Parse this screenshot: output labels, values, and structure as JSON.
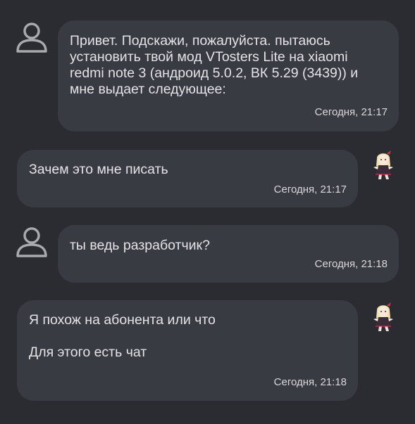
{
  "messages": [
    {
      "sender": "other",
      "text": "Привет. Подскажи, пожалуйста. пытаюсь\nустановить твой мод VTosters Lite на xiaomi\nredmi note 3 (андроид 5.0.2, ВК 5.29 (3439)) и\nмне выдает следующее:",
      "time": "Сегодня, 21:17",
      "avatar": "default-user-icon"
    },
    {
      "sender": "self",
      "text": "Зачем это мне писать",
      "time": "Сегодня, 21:17",
      "avatar": "anime-girl-avatar"
    },
    {
      "sender": "other",
      "text": "ты ведь разработчик?",
      "time": "Сегодня, 21:18",
      "avatar": "default-user-icon"
    },
    {
      "sender": "self",
      "text": "Я похож на абонента или что\n\nДля этого есть чат",
      "time": "Сегодня, 21:18",
      "avatar": "anime-girl-avatar"
    }
  ],
  "colors": {
    "background": "#2a2c31",
    "bubble": "#393b42",
    "text": "#e3e4e8",
    "avatar_icon": "#a9aaad"
  }
}
